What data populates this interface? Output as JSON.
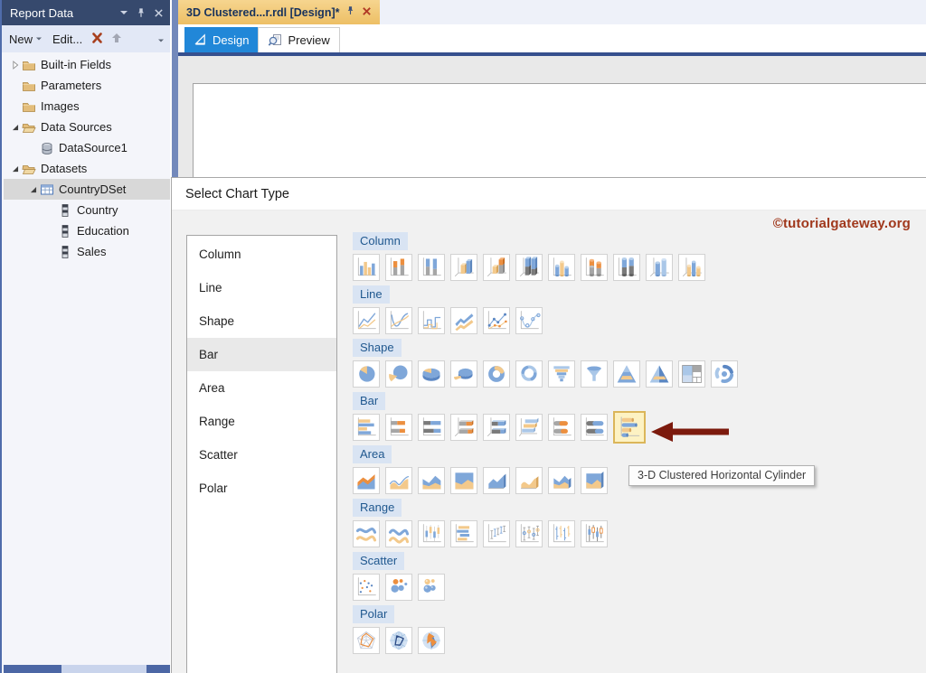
{
  "report_data_panel": {
    "title": "Report Data",
    "toolbar": {
      "new_label": "New",
      "edit_label": "Edit..."
    },
    "tree": [
      {
        "label": "Built-in Fields",
        "icon": "folder-icon",
        "indent": 1,
        "expander": "collapsed",
        "selected": false
      },
      {
        "label": "Parameters",
        "icon": "folder-icon",
        "indent": 1,
        "expander": "none",
        "selected": false
      },
      {
        "label": "Images",
        "icon": "folder-icon",
        "indent": 1,
        "expander": "none",
        "selected": false
      },
      {
        "label": "Data Sources",
        "icon": "folder-open-icon",
        "indent": 1,
        "expander": "expanded",
        "selected": false
      },
      {
        "label": "DataSource1",
        "icon": "database-icon",
        "indent": 2,
        "expander": "none",
        "selected": false
      },
      {
        "label": "Datasets",
        "icon": "folder-open-icon",
        "indent": 1,
        "expander": "expanded",
        "selected": false
      },
      {
        "label": "CountryDSet",
        "icon": "dataset-icon",
        "indent": 2,
        "expander": "expanded",
        "selected": true
      },
      {
        "label": "Country",
        "icon": "field-icon",
        "indent": 3,
        "expander": "none",
        "selected": false
      },
      {
        "label": "Education",
        "icon": "field-icon",
        "indent": 3,
        "expander": "none",
        "selected": false
      },
      {
        "label": "Sales",
        "icon": "field-icon",
        "indent": 3,
        "expander": "none",
        "selected": false
      }
    ]
  },
  "document_tab": {
    "title": "3D Clustered...r.rdl [Design]*"
  },
  "view_tabs": {
    "design_label": "Design",
    "preview_label": "Preview",
    "active": "Design"
  },
  "dialog": {
    "title": "Select Chart Type",
    "watermark": "©tutorialgateway.org",
    "categories": [
      "Column",
      "Line",
      "Shape",
      "Bar",
      "Area",
      "Range",
      "Scatter",
      "Polar"
    ],
    "selected_category": "Bar",
    "tooltip": "3-D Clustered Horizontal Cylinder",
    "selected_chart_type": "three-d-clustered-horizontal-cylinder",
    "sections": [
      {
        "label": "Column",
        "icons": [
          "clustered-column",
          "stacked-column",
          "percent-stacked-column",
          "three-d-clustered-column",
          "three-d-stacked-column",
          "three-d-percent-stacked-column",
          "clustered-cylinder",
          "stacked-cylinder",
          "percent-stacked-cylinder",
          "three-d-clustered-cylinder",
          "three-d-stacked-cylinder"
        ]
      },
      {
        "label": "Line",
        "icons": [
          "line",
          "smooth-line",
          "stepped-line",
          "three-d-line",
          "line-with-markers",
          "smooth-line-with-markers"
        ]
      },
      {
        "label": "Shape",
        "icons": [
          "pie",
          "exploded-pie",
          "three-d-pie",
          "three-d-exploded-pie",
          "doughnut",
          "three-d-doughnut",
          "funnel",
          "three-d-funnel",
          "pyramid",
          "three-d-pyramid",
          "treemap",
          "sunburst"
        ]
      },
      {
        "label": "Bar",
        "icons": [
          "clustered-bar",
          "stacked-bar",
          "percent-stacked-bar",
          "three-d-stacked-bar",
          "three-d-percent-stacked-bar",
          "three-d-clustered-bar",
          "stacked-horizontal-cylinder",
          "percent-stacked-horizontal-cylinder",
          "three-d-clustered-horizontal-cylinder"
        ]
      },
      {
        "label": "Area",
        "icons": [
          "area",
          "smooth-area",
          "stacked-area",
          "percent-stacked-area",
          "three-d-area",
          "three-d-smooth-area",
          "three-d-stacked-area",
          "three-d-percent-stacked-area"
        ]
      },
      {
        "label": "Range",
        "icons": [
          "range",
          "smooth-range",
          "range-column",
          "range-bar",
          "error-bar",
          "boxplot",
          "stock",
          "candlestick"
        ]
      },
      {
        "label": "Scatter",
        "icons": [
          "scatter",
          "bubble",
          "three-d-bubble"
        ]
      },
      {
        "label": "Polar",
        "icons": [
          "radar",
          "polar",
          "three-d-polar"
        ]
      }
    ]
  },
  "colors": {
    "panel_titlebar": "#36496d",
    "document_tab_gold": "#f0c97e",
    "design_tab_active_blue": "#2187d8",
    "highlight_tile_bg": "#fdf2c3",
    "highlight_tile_border": "#dbb65a",
    "annotation_arrow": "#7c1a0d",
    "watermark_red": "#a0381c",
    "section_chip_bg": "#d9e4f3",
    "section_chip_text": "#20588f"
  }
}
